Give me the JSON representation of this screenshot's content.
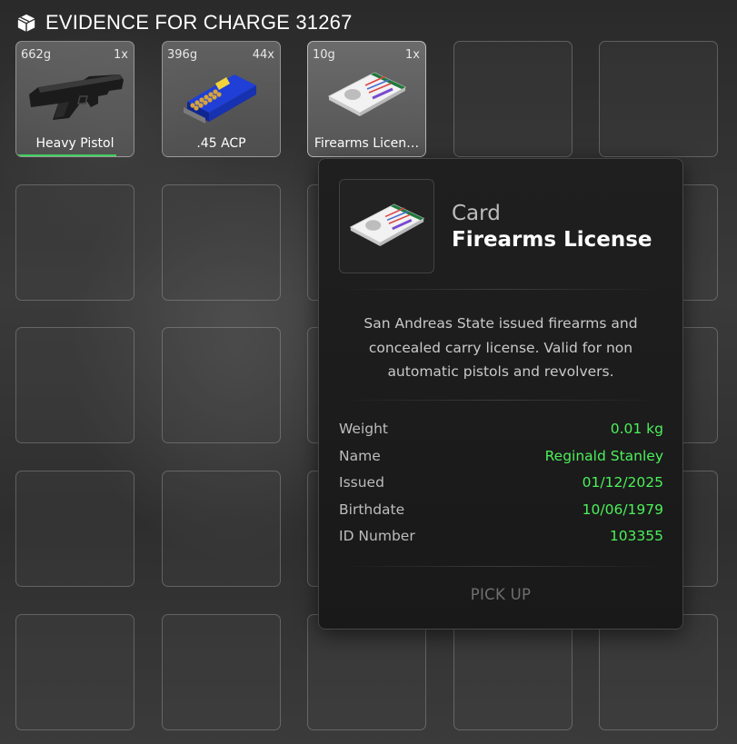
{
  "header": {
    "icon": "box-icon",
    "title": "EVIDENCE FOR CHARGE 31267"
  },
  "inventory": {
    "items": [
      {
        "weight": "662g",
        "count": "1x",
        "label": "Heavy Pistol",
        "icon": "pistol-icon",
        "durability": 0.85
      },
      {
        "weight": "396g",
        "count": "44x",
        "label": ".45 ACP",
        "icon": "ammo-box-icon"
      },
      {
        "weight": "10g",
        "count": "1x",
        "label": "Firearms Licen…",
        "icon": "license-card-icon"
      }
    ]
  },
  "tooltip": {
    "type": "Card",
    "name": "Firearms License",
    "icon": "license-card-icon",
    "description": "San Andreas State issued firearms and concealed carry license. Valid for non automatic pistols and revolvers.",
    "properties": [
      {
        "key": "Weight",
        "value": "0.01 kg"
      },
      {
        "key": "Name",
        "value": "Reginald Stanley"
      },
      {
        "key": "Issued",
        "value": "01/12/2025"
      },
      {
        "key": "Birthdate",
        "value": "10/06/1979"
      },
      {
        "key": "ID Number",
        "value": "103355"
      }
    ],
    "action": "PICK UP"
  },
  "colors": {
    "value_green": "#4cf05a",
    "durability_green": "#3fcf5e",
    "panel_bg": "#1c1c1c"
  }
}
